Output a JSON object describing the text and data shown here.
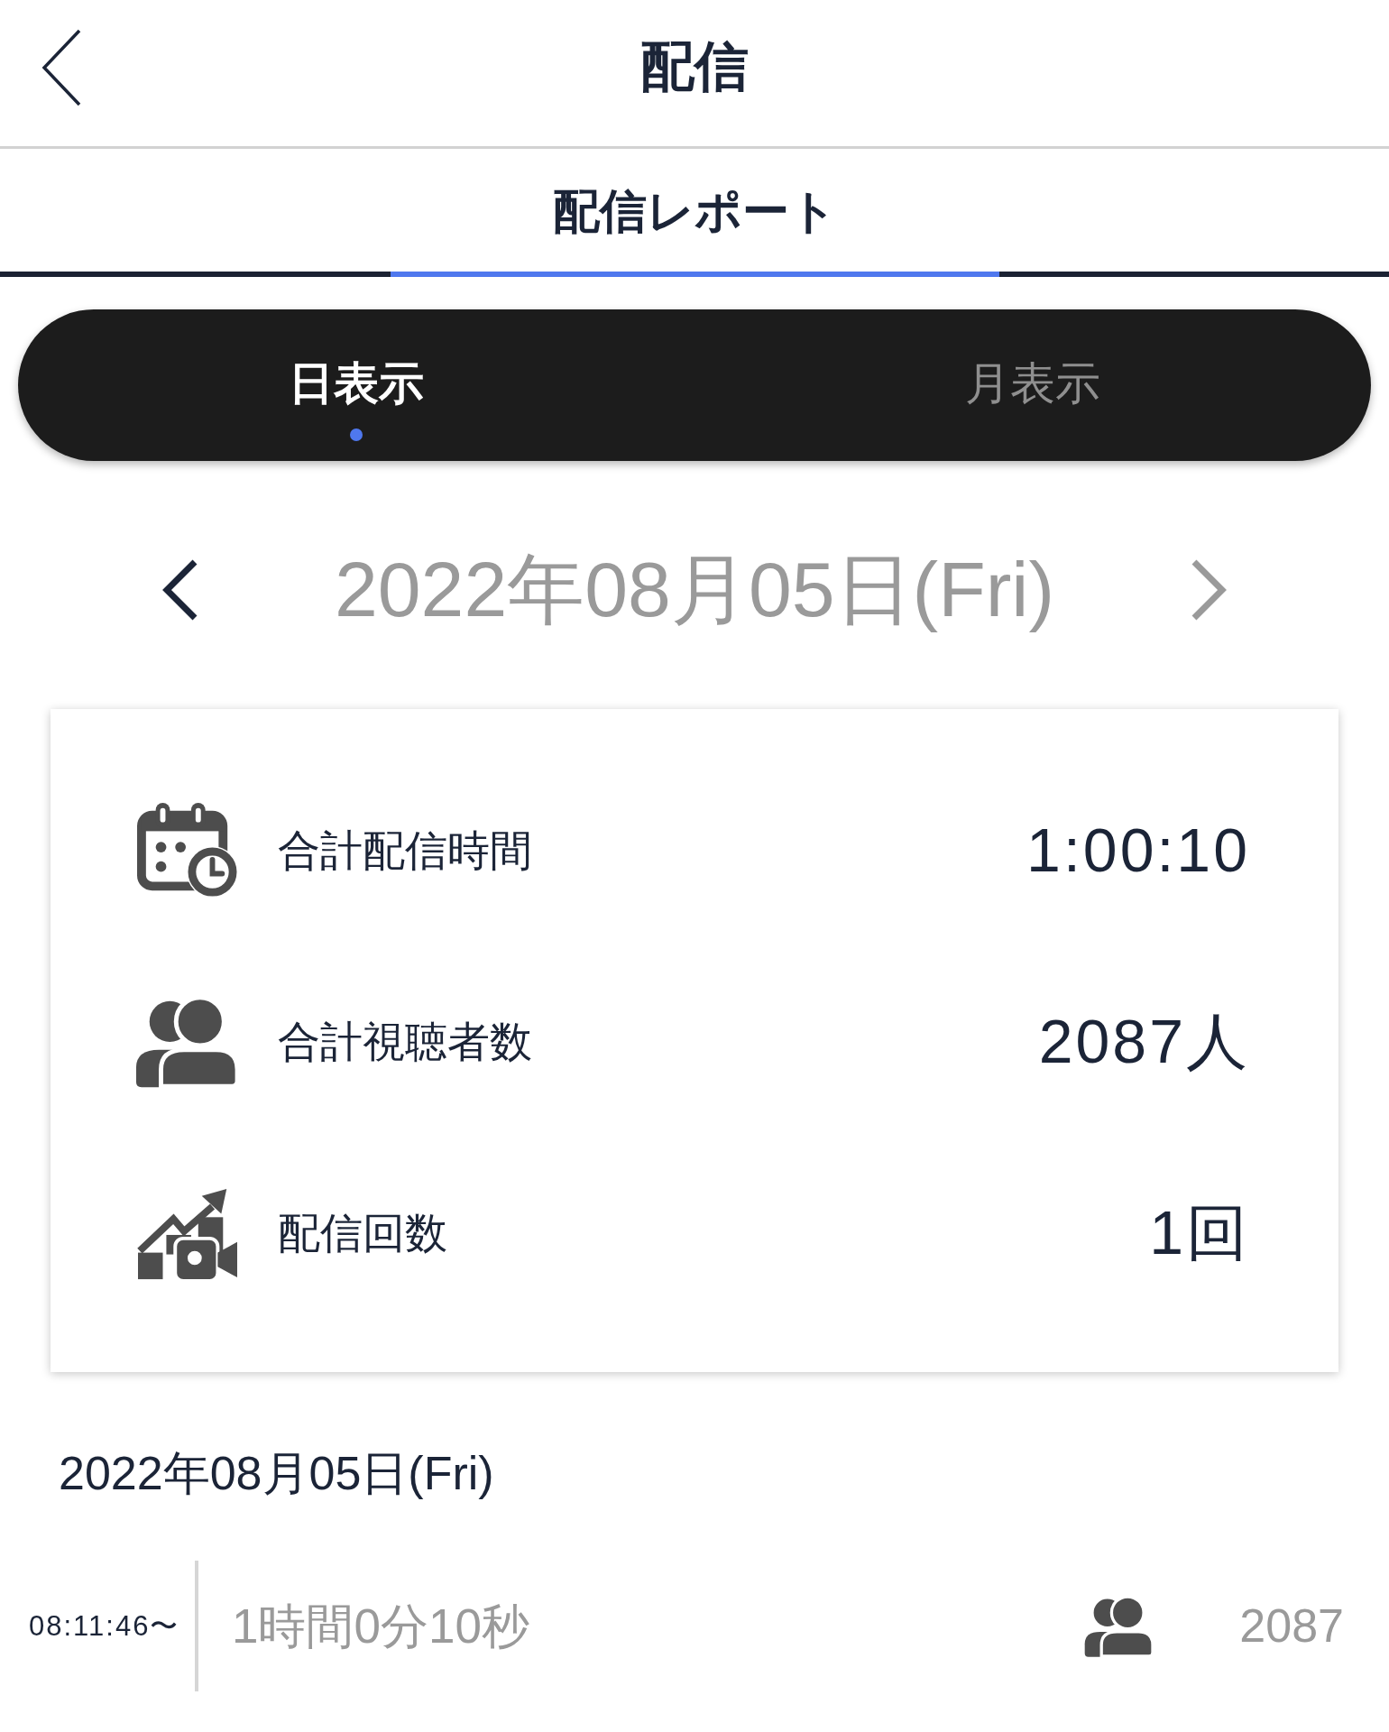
{
  "header": {
    "title": "配信"
  },
  "tabs": [
    {
      "label": "配信レポート",
      "selected": true
    }
  ],
  "view_toggle": [
    {
      "label": "日表示",
      "selected": true
    },
    {
      "label": "月表示",
      "selected": false
    }
  ],
  "date_nav": {
    "date": "2022年08月05日(Fri)",
    "prev": {
      "disabled": false
    },
    "next": {
      "disabled": true
    }
  },
  "summary": [
    {
      "kind": "time",
      "label": "合計配信時間",
      "value": "1:00:10"
    },
    {
      "kind": "viewers",
      "label": "合計視聴者数",
      "value": "2087人"
    },
    {
      "kind": "count",
      "label": "配信回数",
      "value": "1回"
    }
  ],
  "sessions": {
    "date": "2022年08月05日(Fri)",
    "items": [
      {
        "start": "08:11:46〜",
        "duration": "1時間0分10秒",
        "viewers": "2087"
      }
    ]
  }
}
